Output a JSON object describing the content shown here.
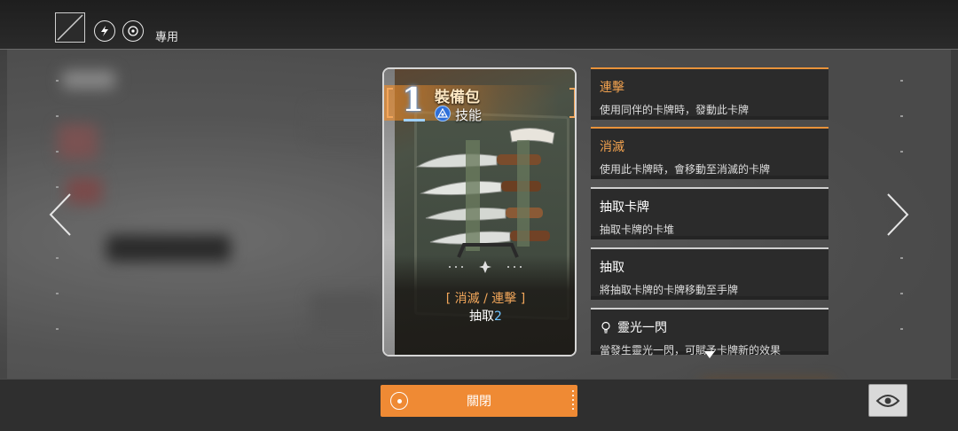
{
  "top_bar": {
    "exclusive_label": "專用",
    "icons": [
      "slash-filter-icon",
      "lightning-icon",
      "target-icon"
    ]
  },
  "card": {
    "cost": "1",
    "name": "裝備包",
    "type": "技能",
    "type_icon": "skill-icon",
    "keywords_line": "[ 消滅 / 連擊 ]",
    "effect_prefix": "抽取",
    "effect_value": "2",
    "art": "knife-case-art"
  },
  "keywords": [
    {
      "title": "連擊",
      "desc": "使用同伴的卡牌時，發動此卡牌",
      "style": "orange"
    },
    {
      "title": "消滅",
      "desc": "使用此卡牌時，會移動至消滅的卡牌",
      "style": "orange"
    },
    {
      "title": "抽取卡牌",
      "desc": "抽取卡牌的卡堆",
      "style": "white"
    },
    {
      "title": "抽取",
      "desc": "將抽取卡牌的卡牌移動至手牌",
      "style": "white"
    },
    {
      "title": "靈光一閃",
      "desc": "當發生靈光一閃，可賦予卡牌新的效果",
      "style": "white",
      "icon": "lightbulb-icon"
    }
  ],
  "buttons": {
    "close_label": "關閉",
    "eye_icon": "eye-icon"
  },
  "colors": {
    "accent_orange": "#ef8a34",
    "keyword_orange": "#f2a24f",
    "draw_number_blue": "#6fc3ff"
  }
}
